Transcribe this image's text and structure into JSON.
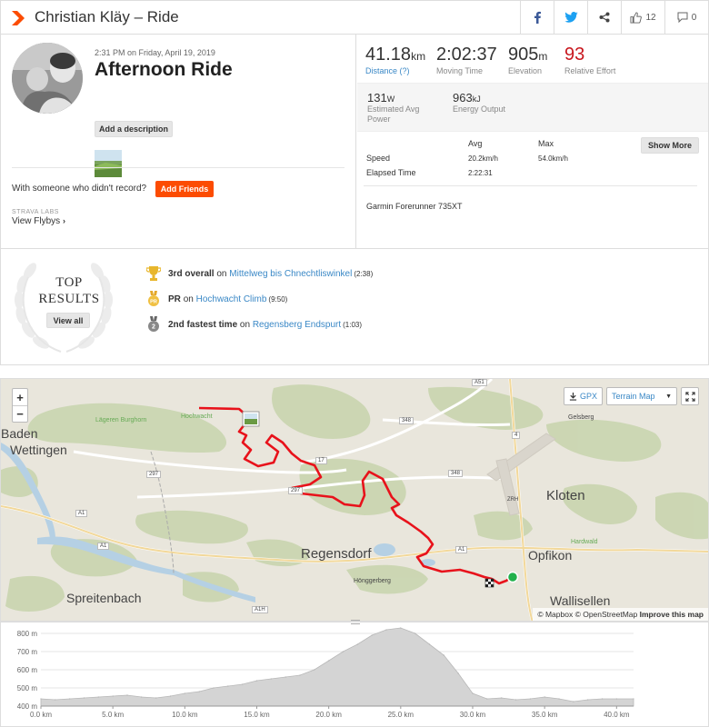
{
  "header": {
    "title": "Christian Kläy – Ride",
    "like_count": "12",
    "comment_count": "0"
  },
  "activity": {
    "datetime": "2:31 PM on Friday, April 19, 2019",
    "name": "Afternoon Ride",
    "add_description_label": "Add a description",
    "with_someone_text": "With someone who didn't record?",
    "add_friends_label": "Add Friends",
    "labs_label": "STRAVA LABS",
    "view_flybys_label": "View Flybys"
  },
  "stats_primary": [
    {
      "value": "41.18",
      "unit": "km",
      "label": "Distance (?)"
    },
    {
      "value": "2:02:37",
      "unit": "",
      "label": "Moving Time"
    },
    {
      "value": "905",
      "unit": "m",
      "label": "Elevation"
    },
    {
      "value": "93",
      "unit": "",
      "label": "Relative Effort"
    }
  ],
  "stats_secondary": [
    {
      "value": "131",
      "unit": "W",
      "label_line1": "Estimated Avg",
      "label_line2": "Power"
    },
    {
      "value": "963",
      "unit": "kJ",
      "label_line1": "Energy Output",
      "label_line2": ""
    }
  ],
  "detail_table": {
    "col_avg": "Avg",
    "col_max": "Max",
    "speed_label": "Speed",
    "speed_avg": "20.2km/h",
    "speed_max": "54.0km/h",
    "elapsed_label": "Elapsed Time",
    "elapsed_value": "2:22:31",
    "show_more_label": "Show More"
  },
  "device": "Garmin Forerunner 735XT",
  "top_results": {
    "title_line1": "TOP",
    "title_line2": "RESULTS",
    "view_all_label": "View all",
    "items": [
      {
        "rank": "3rd overall",
        "on": "on",
        "segment": "Mittelweg bis Chnechtliswinkel",
        "time": "(2:38)",
        "medal_color": "#e8b62c"
      },
      {
        "rank": "PR",
        "on": "on",
        "segment": "Hochwacht Climb",
        "time": "(9:50)",
        "medal_color": "#f0c042"
      },
      {
        "rank": "2nd fastest time",
        "on": "on",
        "segment": "Regensberg Endspurt",
        "time": "(1:03)",
        "medal_color": "#888888"
      }
    ]
  },
  "map": {
    "gpx_label": "GPX",
    "map_type_label": "Terrain Map",
    "attribution_mapbox": "© Mapbox",
    "attribution_osm": "© OpenStreetMap",
    "attribution_improve": "Improve this map",
    "place_labels": [
      "Baden",
      "Wettingen",
      "Lägeren Burghorn",
      "Hochwacht",
      "Regensdorf",
      "Kloten",
      "Opfikon",
      "Wallisellen",
      "Spreitenbach",
      "Hönggerberg",
      "Gelsberg",
      "Hardwald"
    ],
    "road_labels": [
      "348",
      "348",
      "17",
      "297",
      "297",
      "A1",
      "A1",
      "A1",
      "A1H",
      "A51",
      "4",
      "ZRH"
    ],
    "route_color": "#e8121b"
  },
  "elevation": {
    "y_ticks": [
      "800 m",
      "700 m",
      "600 m",
      "500 m",
      "400 m"
    ],
    "x_ticks": [
      "0.0 km",
      "5.0 km",
      "10.0 km",
      "15.0 km",
      "20.0 km",
      "25.0 km",
      "30.0 km",
      "35.0 km",
      "40.0 km"
    ]
  },
  "chart_data": {
    "type": "area",
    "xlabel": "",
    "ylabel": "",
    "x_unit": "km",
    "y_unit": "m",
    "xlim": [
      0,
      41.18
    ],
    "ylim": [
      400,
      830
    ],
    "x": [
      0,
      1,
      2,
      3,
      4,
      5,
      6,
      7,
      8,
      9,
      10,
      11,
      12,
      13,
      14,
      15,
      16,
      17,
      18,
      19,
      20,
      21,
      22,
      23,
      24,
      25,
      26,
      27,
      28,
      29,
      30,
      31,
      32,
      33,
      34,
      35,
      36,
      37,
      38,
      39,
      40,
      41.18
    ],
    "y": [
      440,
      435,
      440,
      445,
      450,
      455,
      460,
      450,
      445,
      455,
      470,
      480,
      500,
      510,
      520,
      540,
      550,
      560,
      570,
      600,
      650,
      700,
      740,
      790,
      820,
      830,
      800,
      740,
      680,
      580,
      470,
      440,
      445,
      435,
      440,
      450,
      440,
      425,
      435,
      440,
      440,
      440
    ]
  }
}
